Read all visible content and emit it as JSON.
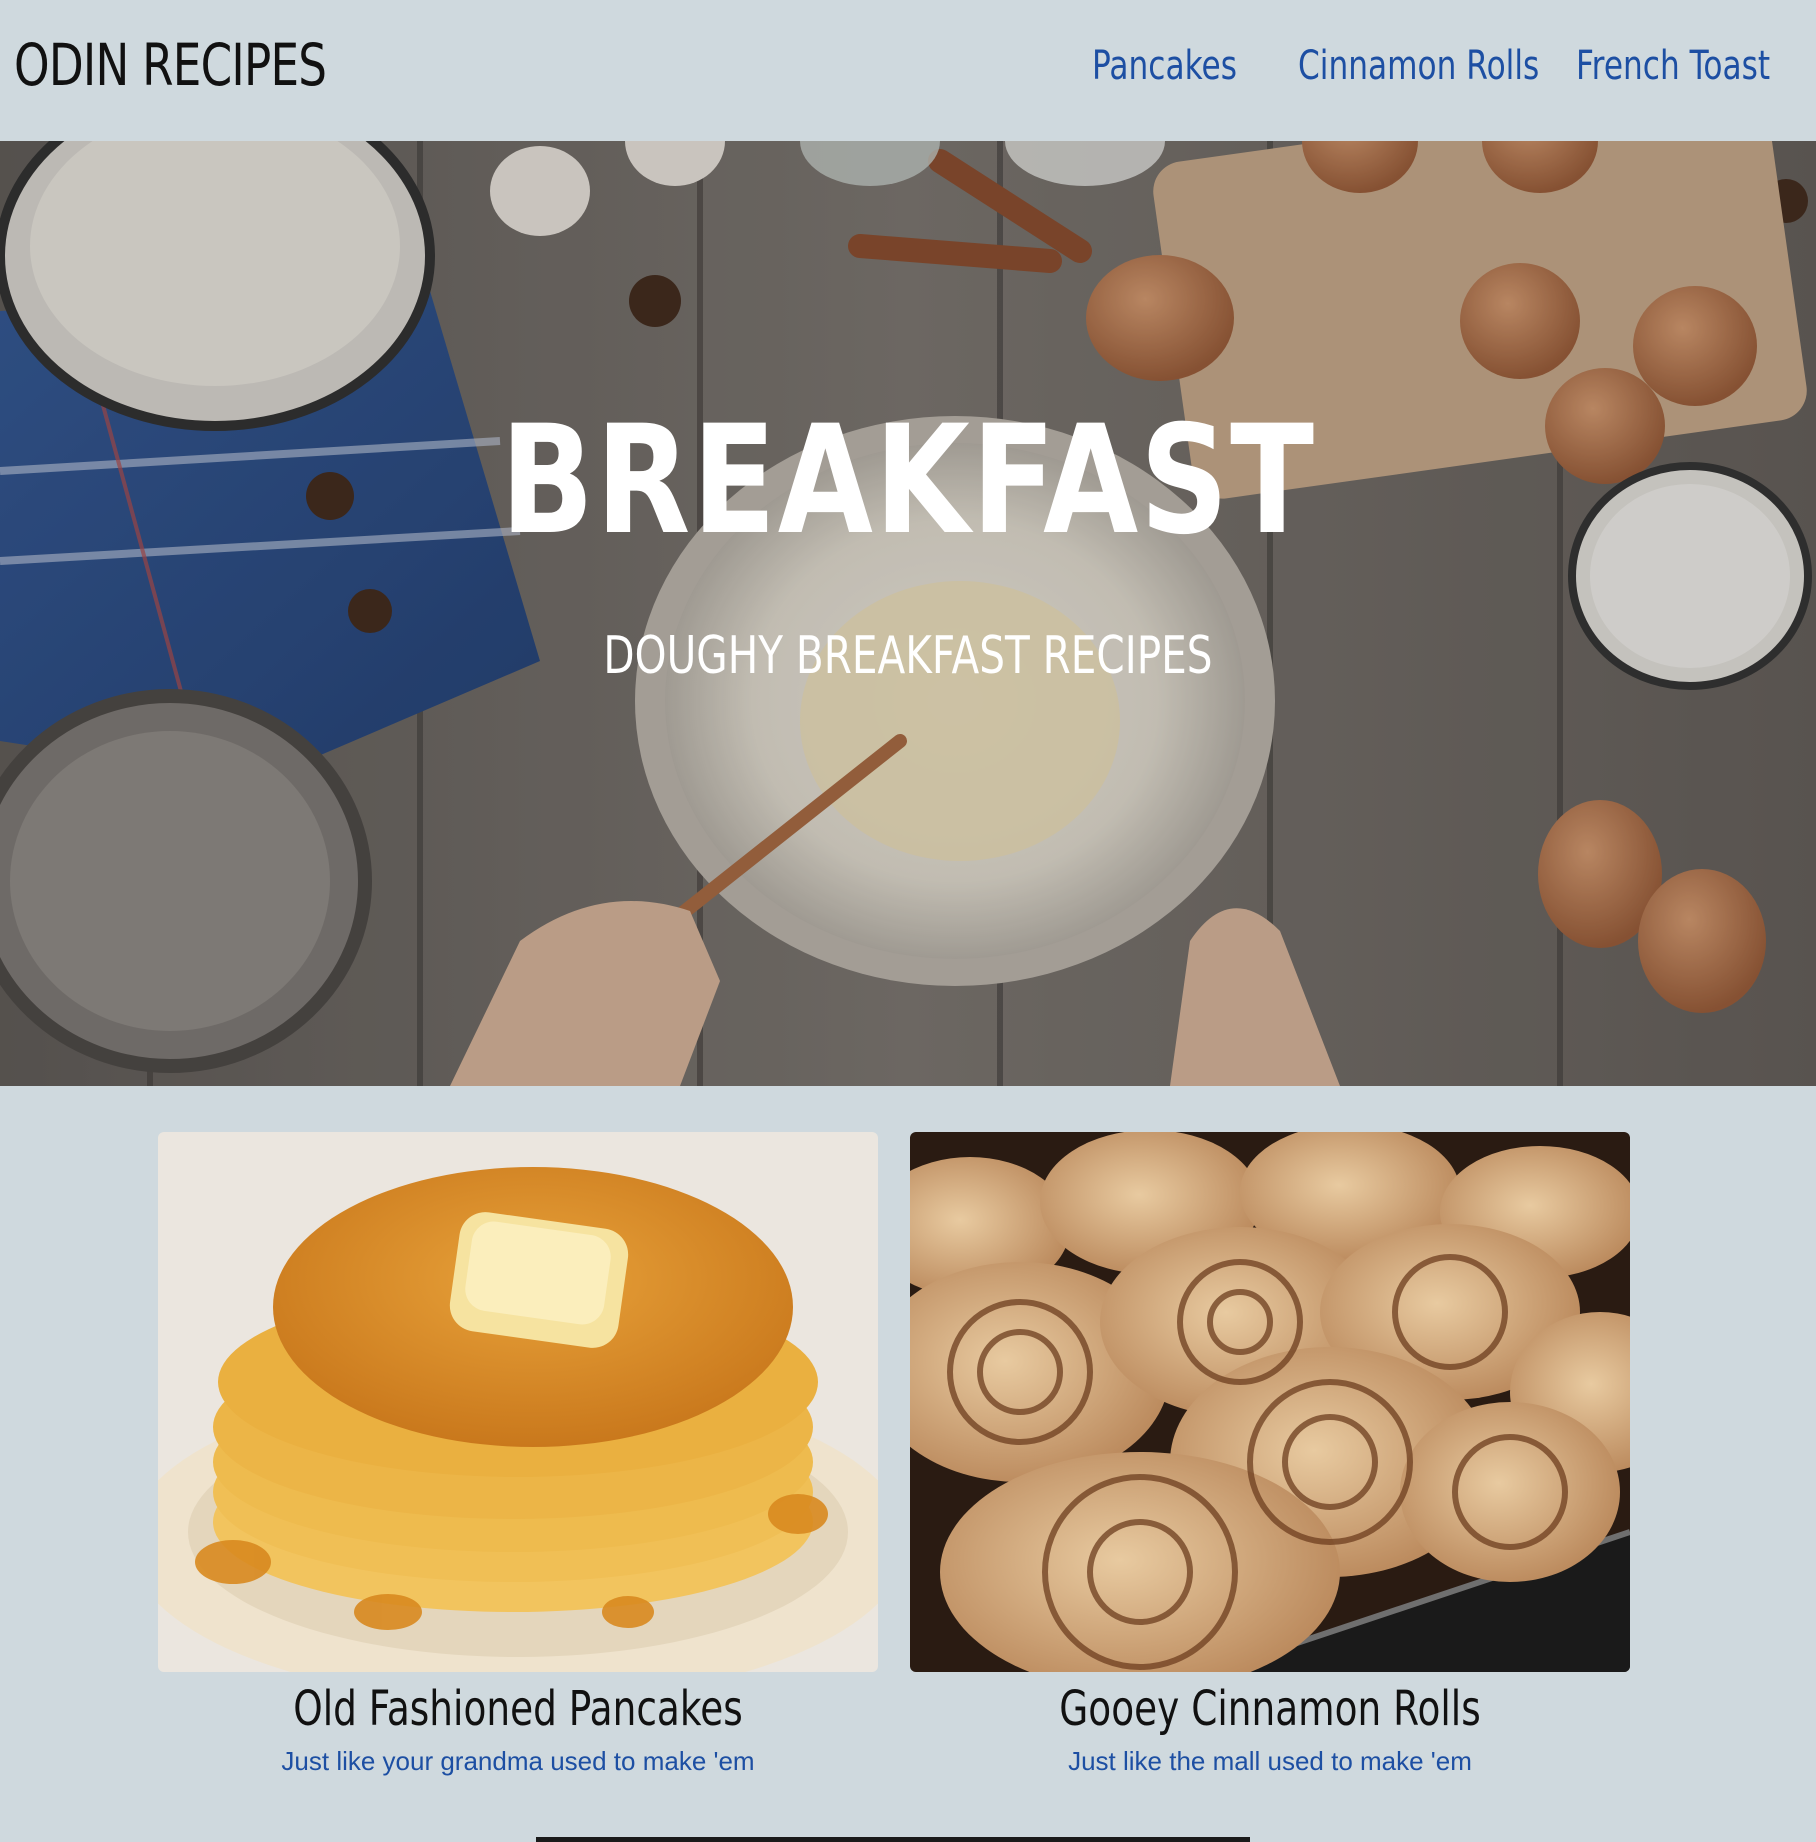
{
  "header": {
    "logo": "ODIN RECIPES",
    "nav": [
      {
        "label": "Pancakes"
      },
      {
        "label": "Cinnamon Rolls"
      },
      {
        "label": "French Toast"
      }
    ]
  },
  "hero": {
    "title": "BREAKFAST",
    "subtitle": "DOUGHY BREAKFAST RECIPES"
  },
  "cards": [
    {
      "title": "Old Fashioned Pancakes",
      "description": "Just like your grandma used to make 'em"
    },
    {
      "title": "Gooey Cinnamon Rolls",
      "description": "Just like the mall used to make 'em"
    }
  ],
  "colors": {
    "background": "#cfd9de",
    "link": "#1d4fa3",
    "text": "#111111"
  }
}
